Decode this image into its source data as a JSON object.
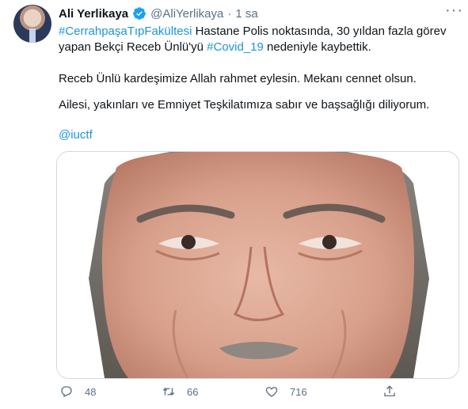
{
  "author": {
    "name": "Ali Yerlikaya",
    "handle": "@AliYerlikaya",
    "separator": "·",
    "time": "1 sa",
    "verified": true,
    "avatar_icon": "profile-photo"
  },
  "tweet": {
    "line1_hashtag": "#CerrahpaşaTıpFakültesi",
    "line1_text": " Hastane Polis noktasında, 30 yıldan fazla görev yapan Bekçi Receb Ünlü'yü ",
    "line1_hashtag2": "#Covid_19",
    "line1_text2": " nedeniyle kaybettik.",
    "line2": "Receb Ünlü kardeşimize Allah rahmet eylesin. Mekanı cennet olsun.",
    "line3": "Ailesi, yakınları ve Emniyet Teşkilatımıza sabır ve başsağlığı diliyorum.",
    "mention": "@iuctf"
  },
  "media": {
    "type": "photo",
    "subject": "portrait"
  },
  "actions": {
    "reply_count": "48",
    "retweet_count": "66",
    "like_count": "716"
  },
  "colors": {
    "link": "#1b95e0",
    "verified": "#1da1f2",
    "muted": "#5b7083",
    "border": "#cfd9de"
  }
}
